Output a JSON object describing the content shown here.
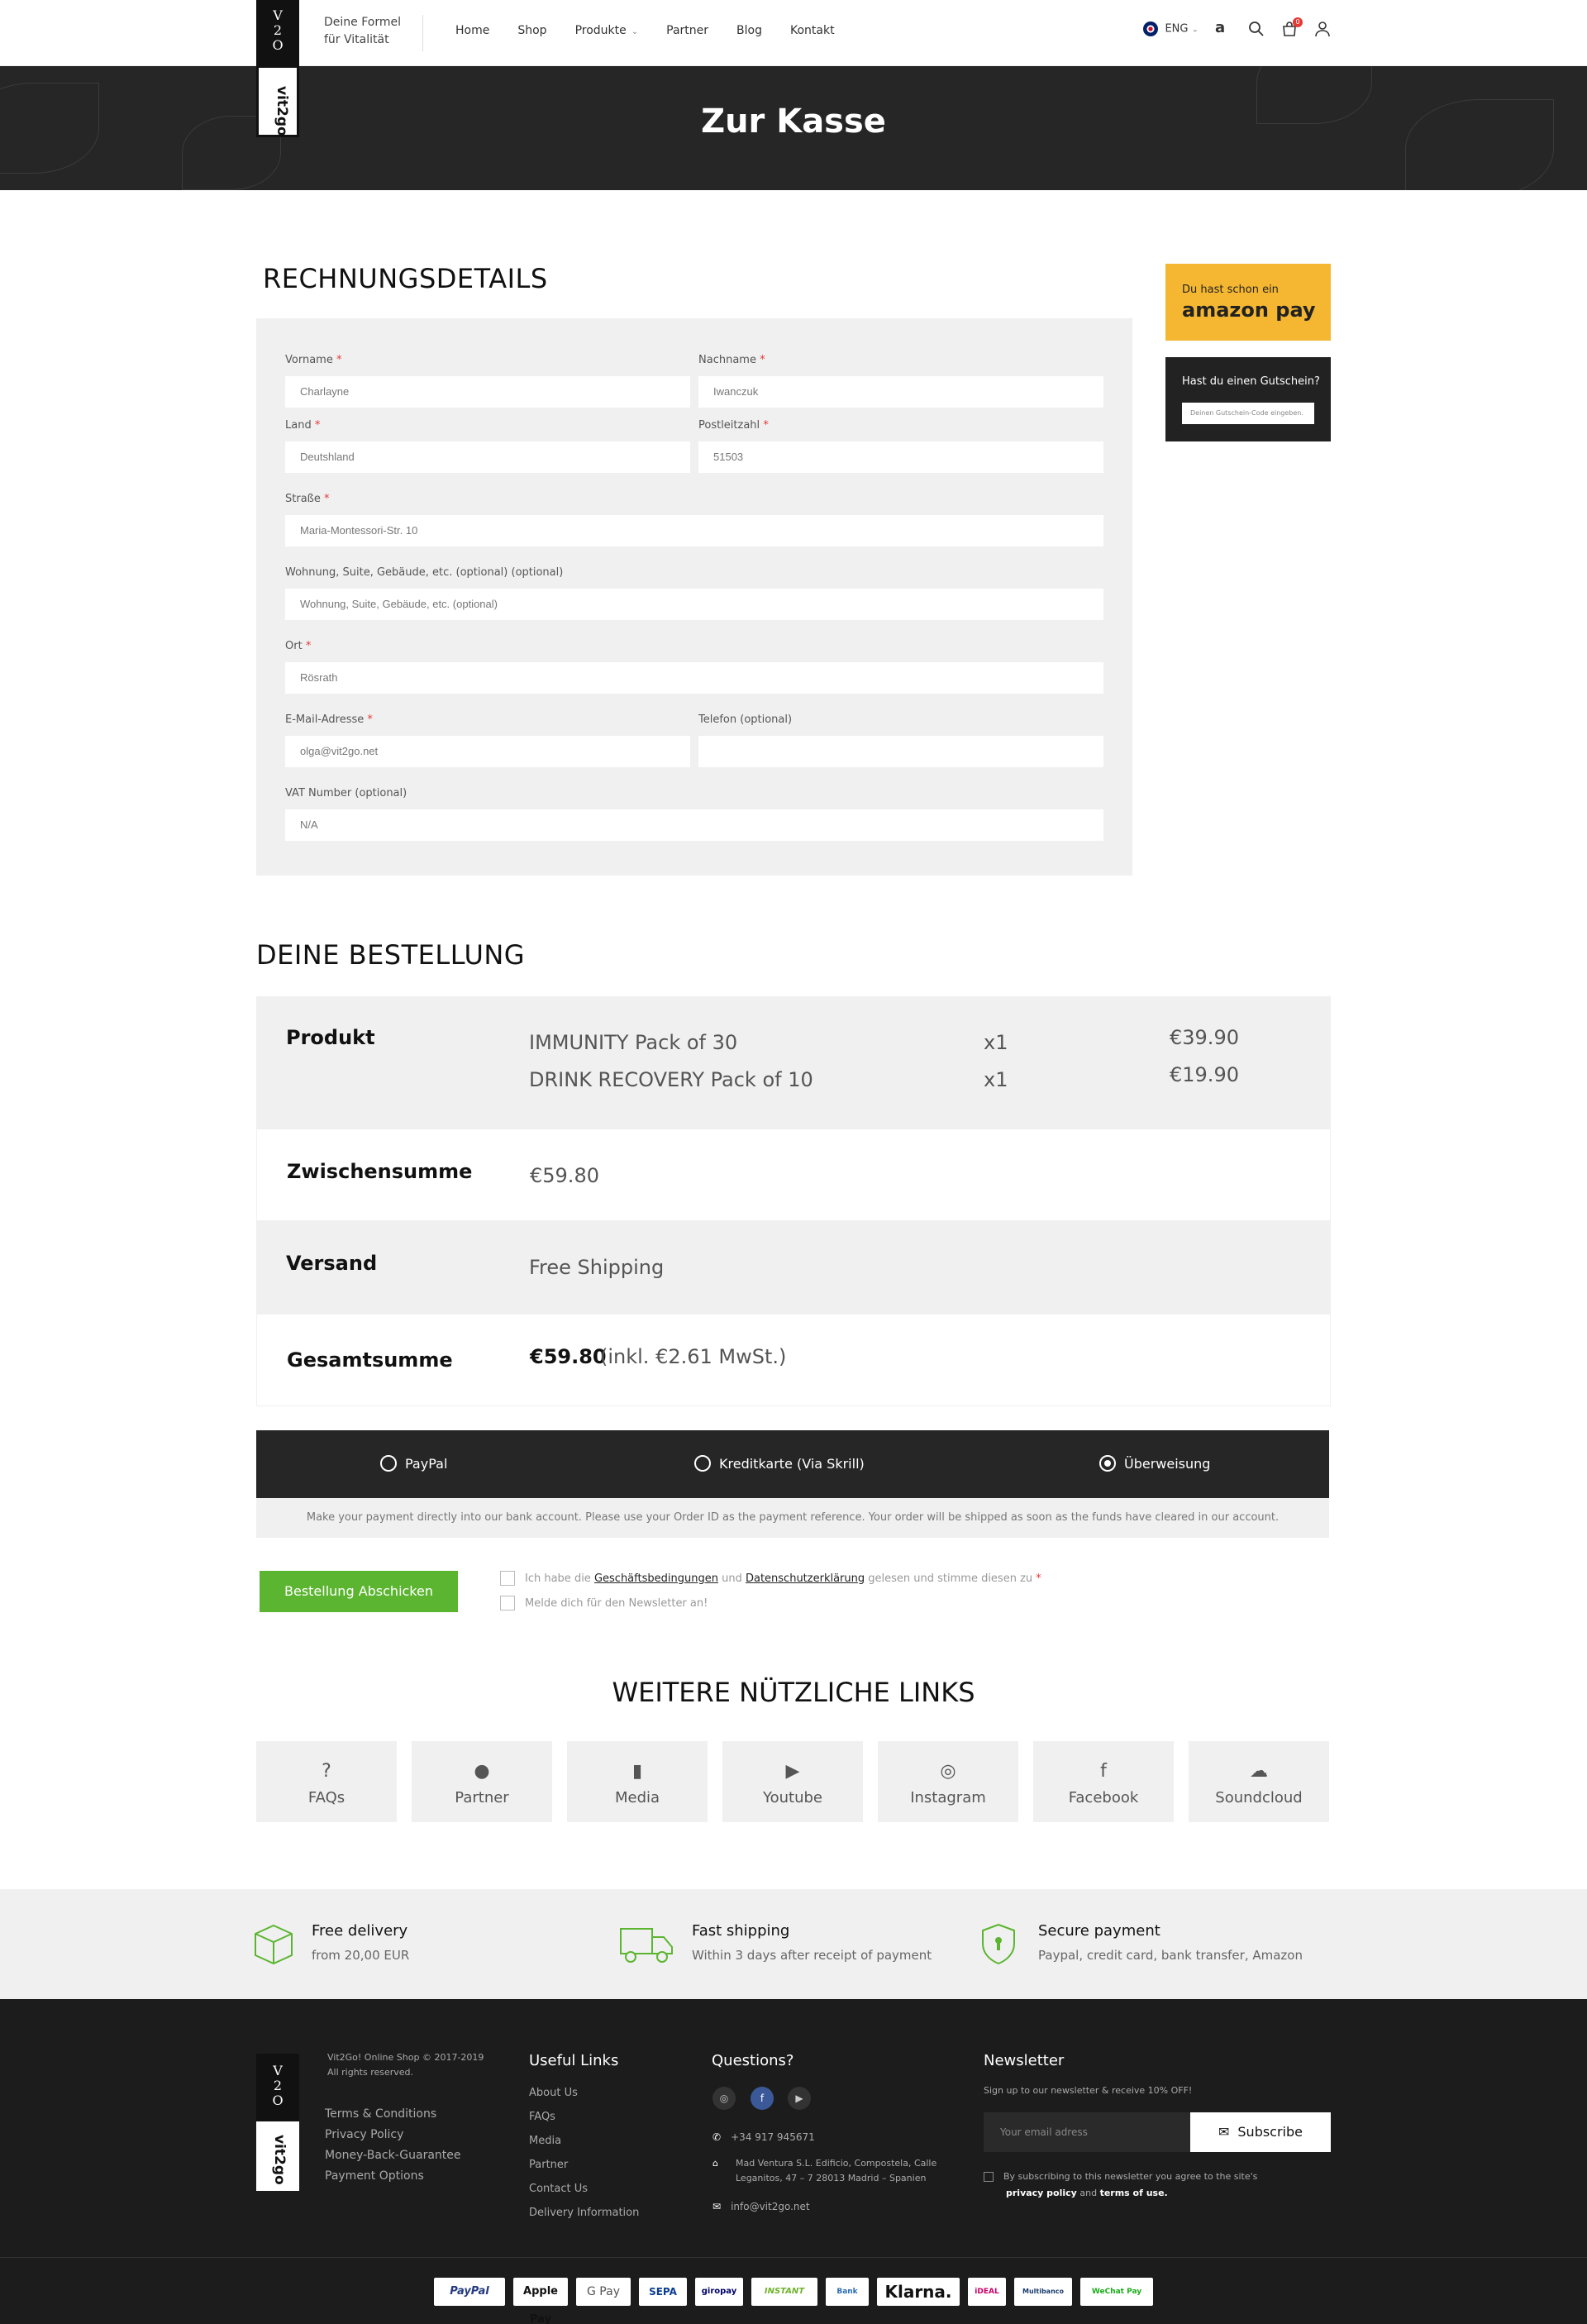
{
  "header": {
    "logo_top": "V\n2\nO",
    "logo_word": "vit2go",
    "tagline_line1": "Deine Formel",
    "tagline_line2": "für Vitalität",
    "nav": [
      "Home",
      "Shop",
      "Produkte",
      "Partner",
      "Blog",
      "Kontakt"
    ],
    "language": "ENG",
    "cart_count": "0"
  },
  "hero": {
    "title": "Zur Kasse"
  },
  "billing": {
    "title": "RECHNUNGSDETAILS",
    "fields": {
      "vorname": {
        "label": "Vorname",
        "value": "Charlayne"
      },
      "nachname": {
        "label": "Nachname",
        "value": "Iwanczuk"
      },
      "land": {
        "label": "Land",
        "value": "Deutshland"
      },
      "plz": {
        "label": "Postleitzahl",
        "value": "51503"
      },
      "strasse": {
        "label": "Straße",
        "value": "Maria-Montessori-Str. 10"
      },
      "wohnung": {
        "label": "Wohnung, Suite, Gebäude, etc. (optional) (optional)",
        "placeholder": "Wohnung, Suite, Gebäude, etc. (optional)"
      },
      "ort": {
        "label": "Ort",
        "value": "Rösrath"
      },
      "email": {
        "label": "E-Mail-Adresse",
        "value": "olga@vit2go.net"
      },
      "telefon": {
        "label": "Telefon (optional)",
        "value": ""
      },
      "vat": {
        "label": "VAT Number (optional)",
        "value": "N/A"
      }
    }
  },
  "sidebar": {
    "amazon_small": "Du hast schon ein",
    "amazon_big": "amazon pay",
    "coupon_title": "Hast du einen Gutschein?",
    "coupon_placeholder": "Deinen Gutschein-Code eingeben."
  },
  "order": {
    "title": "DEINE BESTELLUNG",
    "product_label": "Produkt",
    "items": [
      {
        "name": "IMMUNITY Pack of 30",
        "qty": "x1",
        "price": "€39.90"
      },
      {
        "name": "DRINK RECOVERY Pack of 10",
        "qty": "x1",
        "price": "€19.90"
      }
    ],
    "subtotal_label": "Zwischensumme",
    "subtotal": "€59.80",
    "shipping_label": "Versand",
    "shipping": "Free Shipping",
    "total_label": "Gesamtsumme",
    "total": "€59.80",
    "tax_note": "(inkl. €2.61 MwSt.)"
  },
  "payment": {
    "options": [
      "PayPal",
      "Kreditkarte (Via Skrill)",
      "Überweisung"
    ],
    "selected": "Überweisung",
    "note": "Make your payment directly into our bank account. Please use your Order ID as the payment reference. Your order will be shipped as soon as the funds have cleared in our account.",
    "submit": "Bestellung Abschicken",
    "terms_pre": "Ich habe die",
    "terms_link1": "Geschäftsbedingungen",
    "terms_mid": "und",
    "terms_link2": "Datenschutzerklärung",
    "terms_post": "gelesen und stimme diesen zu",
    "newsletter": "Melde dich für den Newsletter an!"
  },
  "links": {
    "title": "WEITERE NÜTZLICHE LINKS",
    "items": [
      {
        "label": "FAQs",
        "icon": "question-icon"
      },
      {
        "label": "Partner",
        "icon": "user-icon"
      },
      {
        "label": "Media",
        "icon": "microphone-icon"
      },
      {
        "label": "Youtube",
        "icon": "youtube-icon"
      },
      {
        "label": "Instagram",
        "icon": "instagram-icon"
      },
      {
        "label": "Facebook",
        "icon": "facebook-icon"
      },
      {
        "label": "Soundcloud",
        "icon": "soundcloud-icon"
      }
    ]
  },
  "features": [
    {
      "title": "Free delivery",
      "sub": "from 20,00 EUR"
    },
    {
      "title": "Fast shipping",
      "sub": "Within 3 days after receipt of payment"
    },
    {
      "title": "Secure payment",
      "sub": "Paypal, credit card, bank transfer, Amazon"
    }
  ],
  "footer": {
    "copyright1": "Vit2Go! Online Shop © 2017-2019",
    "copyright2": "All rights reserved.",
    "legal": [
      "Terms & Conditions",
      "Privacy Policy",
      "Money-Back-Guarantee",
      "Payment Options"
    ],
    "useful_title": "Useful Links",
    "useful": [
      "About Us",
      "FAQs",
      "Media",
      "Partner",
      "Contact Us",
      "Delivery Information"
    ],
    "questions_title": "Questions?",
    "phone": "+34 917 945671",
    "address1": "Mad Ventura S.L. Edificio, Compostela, Calle",
    "address2": "Leganitos, 47 – 7 28013 Madrid – Spanien",
    "email": "info@vit2go.net",
    "news_title": "Newsletter",
    "news_sub": "Sign up to our newsletter & receive 10% OFF!",
    "news_placeholder": "Your email adress",
    "news_button": "Subscribe",
    "news_consent_pre": "By subscribing to this newsletter you agree to the site's",
    "news_consent_link1": "privacy policy",
    "news_consent_and": "and",
    "news_consent_link2": "terms of use."
  },
  "payment_logos": [
    "PayPal",
    "Apple Pay",
    "G Pay",
    "SEPA",
    "giropay",
    "INSTANT",
    "Bank",
    "Klarna.",
    "iDEAL",
    "Multibanco",
    "WeChat Pay"
  ],
  "colors": {
    "accent_green": "#5cb531",
    "dark": "#262626",
    "amazon": "#f5b731",
    "required": "#e53935"
  }
}
